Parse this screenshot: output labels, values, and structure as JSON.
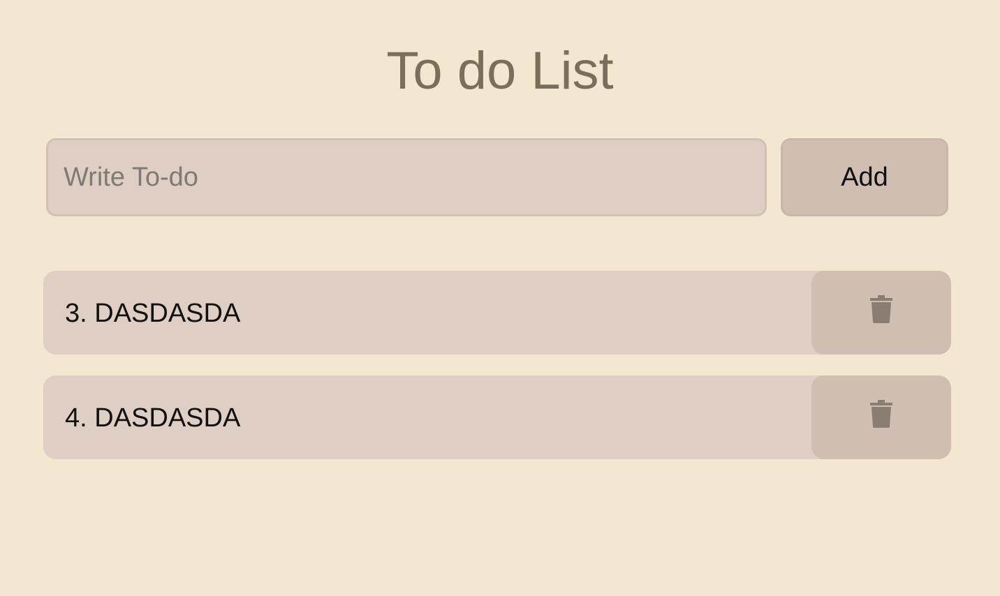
{
  "app": {
    "title": "To do List"
  },
  "form": {
    "input_value": "",
    "input_placeholder": "Write To-do",
    "add_label": "Add"
  },
  "todos": [
    {
      "label": "3. DASDASDA",
      "delete_icon": "trash-icon"
    },
    {
      "label": "4. DASDASDA",
      "delete_icon": "trash-icon"
    }
  ],
  "colors": {
    "background": "#f3e7cf",
    "title": "#7a6e5d",
    "item_background": "#dfcec3",
    "button_background": "#d0beb3",
    "icon": "#8a7d72"
  }
}
